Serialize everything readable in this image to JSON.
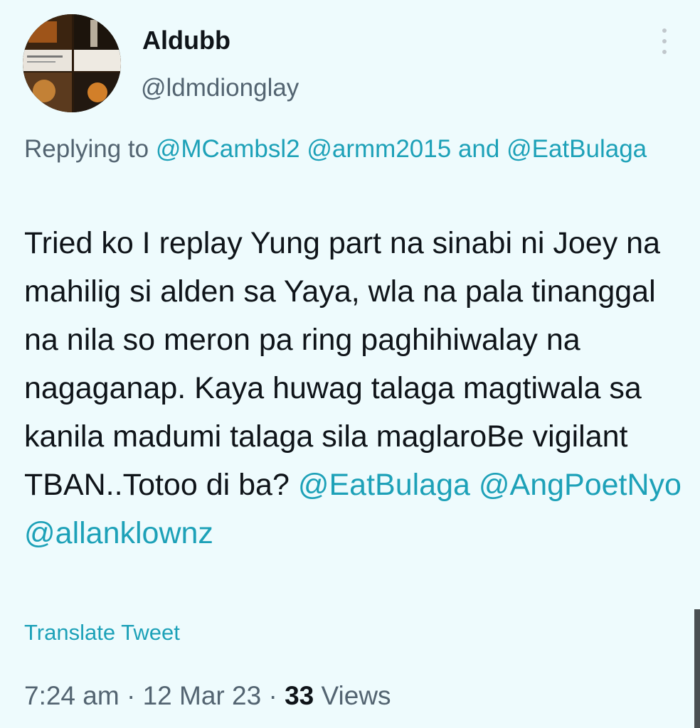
{
  "author": {
    "display_name": "Aldubb",
    "handle": "@ldmdionglay",
    "avatar_icon": "profile-collage-avatar"
  },
  "reply": {
    "prefix": "Replying to",
    "mention_1": "@MCambsl2",
    "mention_2": "@armm2015",
    "conjunction": "and",
    "mention_3": "@EatBulaga"
  },
  "tweet": {
    "text": "Tried ko I replay Yung part na sinabi ni Joey na mahilig si alden sa Yaya, wla na pala tinanggal na nila so meron pa ring paghihiwalay na nagaganap. Kaya huwag talaga magtiwala sa kanila madumi talaga sila maglaroBe vigilant TBAN..Totoo di ba?",
    "mentions": [
      "@EatBulaga",
      "@AngPoetNyo",
      "@allanklownz"
    ]
  },
  "translate_label": "Translate Tweet",
  "meta": {
    "time": "7:24 am",
    "separator": "·",
    "date": "12 Mar 23",
    "views_count": "33",
    "views_label": "Views"
  },
  "colors": {
    "background": "#eefbfd",
    "link": "#1da1b8",
    "secondary_text": "#536471",
    "primary_text": "#0f1419"
  }
}
